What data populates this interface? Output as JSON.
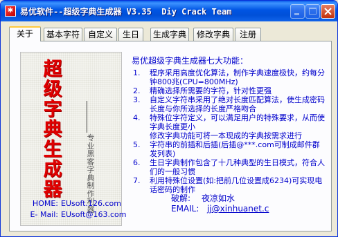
{
  "window": {
    "title": "易优软件--超级字典生成器 V3.35  Diy Crack Team",
    "buttons": [
      "minimize",
      "maximize",
      "close"
    ]
  },
  "tabs": [
    {
      "label": "关于",
      "active": true
    },
    {
      "label": "基本字符",
      "active": false
    },
    {
      "label": "自定义",
      "active": false
    },
    {
      "label": "生日",
      "active": false
    },
    {
      "label": "生成字典",
      "active": false
    },
    {
      "label": "修改字典",
      "active": false
    },
    {
      "label": "注册",
      "active": false
    }
  ],
  "banner": {
    "title_chars": [
      "超",
      "级",
      "字",
      "典",
      "生",
      "成",
      "器"
    ],
    "subtitle": "专业黑客字典制作利器",
    "home_label": "HOME:",
    "home_value": "EUsoft.126.com",
    "email_label": "E- Mail:",
    "email_value": "EUsoft@163.com"
  },
  "features": {
    "title": "易优超级字典生成器七大功能：",
    "items": [
      {
        "num": "1.",
        "text": "程序采用高度优化算法，制作字典速度极快，约每分钟800兆(CPU=800MHz)"
      },
      {
        "num": "2.",
        "text": "精确选择所需要的字符，针对性更强"
      },
      {
        "num": "3.",
        "text": "自定义字符串采用了绝对长度匹配算法，使生成密码长度与你所选择的长度严格吻合"
      },
      {
        "num": "4.",
        "text": "特殊位字符定义，可以满足用户的特殊要求，从而使字典长度更小"
      },
      {
        "num": "",
        "text": "修改字典功能可将一本现成的字典按需求进行"
      },
      {
        "num": "5.",
        "text": "字符串的前插和后插(后插@***.com可制成邮件群发列表)"
      },
      {
        "num": "6.",
        "text": "生日字典制作包含了十几种典型的生日模式，符合人们的一般习惯"
      },
      {
        "num": "7.",
        "text": "利用特殊位设置(如:把前几位设置成6234)可实现电话密码的制作"
      }
    ]
  },
  "crack": {
    "label1": "破解:",
    "value1": "夜凉如水",
    "label2": "EMAIL:",
    "value2": "jj@xinhuanet.c"
  }
}
